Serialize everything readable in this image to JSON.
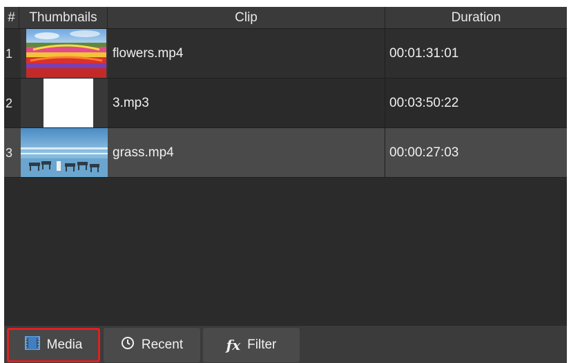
{
  "columns": {
    "num": "#",
    "thumbnails": "Thumbnails",
    "clip": "Clip",
    "duration": "Duration"
  },
  "rows": [
    {
      "num": "1",
      "clip": "flowers.mp4",
      "duration": "00:01:31:01",
      "thumbnail": "flower-field-image"
    },
    {
      "num": "2",
      "clip": "3.mp3",
      "duration": "00:03:50:22",
      "thumbnail": "blank-audio-image"
    },
    {
      "num": "3",
      "clip": "grass.mp4",
      "duration": "00:00:27:03",
      "thumbnail": "beach-horses-image"
    }
  ],
  "selected_row": "3",
  "tabs": [
    {
      "label": "Media",
      "icon": "film-icon",
      "highlighted": true
    },
    {
      "label": "Recent",
      "icon": "clock-icon"
    },
    {
      "label": "Filter",
      "icon": "fx-icon",
      "icon_text": "fx"
    }
  ],
  "colors": {
    "highlight_border": "#e02020",
    "panel_bg": "#2b2b2b",
    "selected_row_bg": "#4a4a4a"
  }
}
